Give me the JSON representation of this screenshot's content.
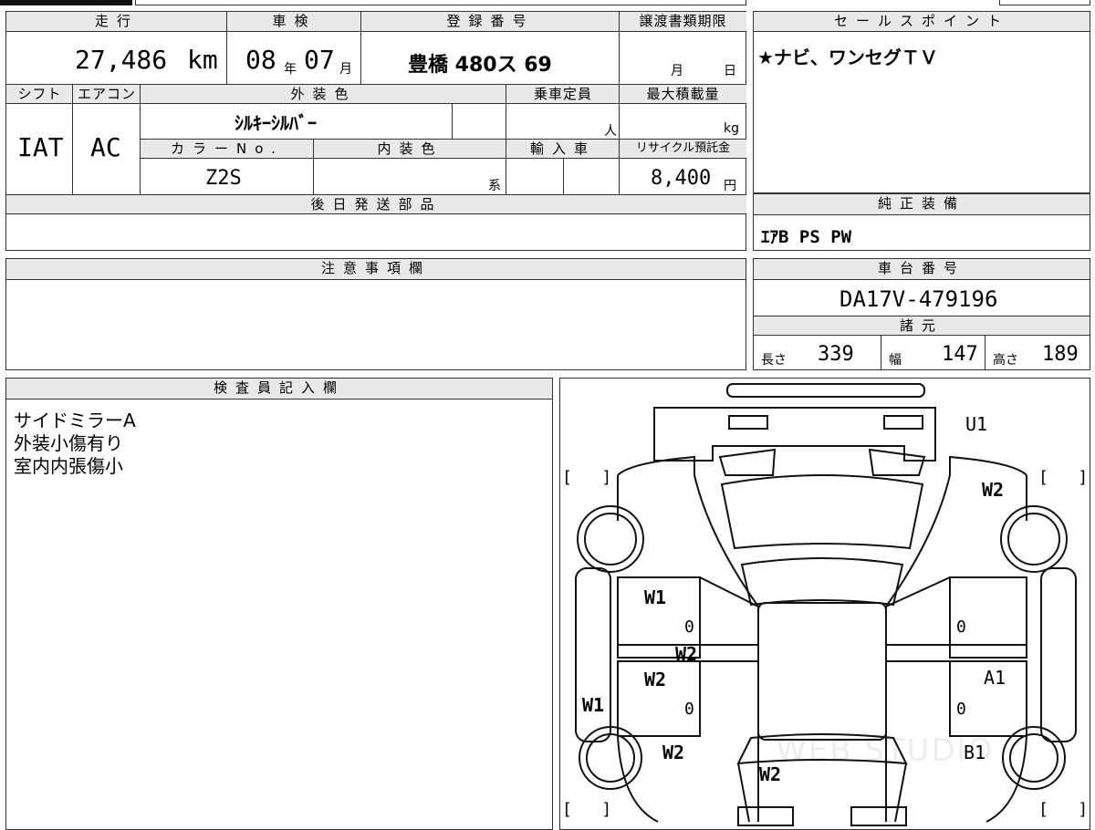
{
  "top_table": {
    "headers": {
      "mileage": "走行",
      "inspection": "車検",
      "registration": "登録番号",
      "transfer_deadline": "譲渡書類期限",
      "shift": "シフト",
      "aircon": "エアコン",
      "exterior_color": "外装色",
      "capacity": "乗車定員",
      "max_load": "最大積載量",
      "color_no": "カラーNo.",
      "interior_color": "内装色",
      "import": "輸入車",
      "recycle_fee": "リサイクル預託金",
      "later_parts": "後日発送部品"
    },
    "mileage_value": "27,486",
    "mileage_unit": "km",
    "inspection_year": "08",
    "year_unit": "年",
    "inspection_month": "07",
    "month_unit": "月",
    "registration_value": "豊橋 480ス  69",
    "deadline_month_unit": "月",
    "deadline_day_unit": "日",
    "shift_value": "IAT",
    "aircon_value": "AC",
    "exterior_color_value": "ｼﾙｷｰｼﾙﾊﾞｰ",
    "capacity_unit": "人",
    "max_load_unit": "kg",
    "color_no_value": "Z2S",
    "interior_color_unit": "系",
    "recycle_fee_value": "8,400",
    "recycle_fee_unit": "円"
  },
  "sales_point": {
    "header": "セールスポイント",
    "text": "★ナビ、ワンセグＴＶ"
  },
  "genuine_equipment": {
    "header": "純正装備",
    "text": "ｴｱB PS PW"
  },
  "notes": {
    "header": "注意事項欄"
  },
  "chassis": {
    "header": "車台番号",
    "value": "DA17V-479196"
  },
  "specs": {
    "header": "諸元",
    "length_label": "長さ",
    "length_value": "339",
    "width_label": "幅",
    "width_value": "147",
    "height_label": "高さ",
    "height_value": "189"
  },
  "inspector": {
    "header": "検査員記入欄",
    "lines": [
      "サイドミラーA",
      "外装小傷有り",
      "室内内張傷小"
    ]
  },
  "diagram": {
    "marks": {
      "front_bumper": "U1",
      "windshield_right": "W2",
      "left_front_fender": "W1",
      "left_front_door_zero": "0",
      "center_pillar": "W2",
      "left_rear_door": "W2",
      "left_rear_door_zero": "0",
      "left_sill": "W1",
      "left_rear_fender": "W2",
      "rear_center": "W2",
      "right_front_door_zero": "0",
      "right_rear_door": "A1",
      "right_rear_door_zero": "0",
      "right_rear_fender": "B1"
    },
    "watermark": "WEB STUDIO"
  }
}
